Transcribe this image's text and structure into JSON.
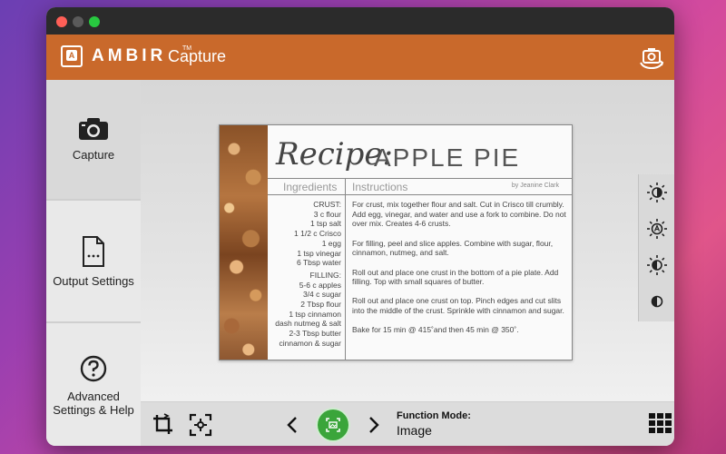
{
  "app": {
    "brand": "AMBIR",
    "trademark": "TM",
    "product": "Capture"
  },
  "sidebar": {
    "items": [
      {
        "label": "Capture",
        "icon": "camera-icon"
      },
      {
        "label": "Output Settings",
        "icon": "document-icon"
      },
      {
        "label": "Advanced Settings & Help",
        "icon": "help-icon"
      }
    ]
  },
  "document": {
    "title_script": "Recipe:",
    "title_main": "APPLE PIE",
    "author": "by Jeanine Clark",
    "ingredients_header": "Ingredients",
    "instructions_header": "Instructions",
    "ingredients": [
      "CRUST:",
      "3 c flour",
      "1 tsp salt",
      "1 1/2 c Crisco",
      "1 egg",
      "1 tsp vinegar",
      "6 Tbsp water",
      "FILLING:",
      "5-6 c apples",
      "3/4 c sugar",
      "2 Tbsp flour",
      "1 tsp cinnamon",
      "dash nutmeg & salt",
      "2-3 Tbsp butter",
      "cinnamon & sugar"
    ],
    "instructions": [
      "For crust, mix together flour and salt. Cut in Crisco till crumbly. Add egg, vinegar, and water and use a fork to combine. Do not over mix. Creates 4-6 crusts.",
      "For filling, peel and slice apples. Combine with sugar, flour, cinnamon, nutmeg, and salt.",
      "Roll out and place one crust in the bottom of a pie plate. Add filling. Top with small squares of butter.",
      "Roll out and place one crust on top. Pinch edges and cut slits into the middle of the crust. Sprinkle with cinnamon and sugar.",
      "Bake for 15 min @ 415˚and then 45 min @ 350˚."
    ]
  },
  "bottom": {
    "function_mode_label": "Function Mode:",
    "function_mode_value": "Image"
  },
  "colors": {
    "accent": "#c9692b",
    "scan_green": "#3aa53a"
  }
}
